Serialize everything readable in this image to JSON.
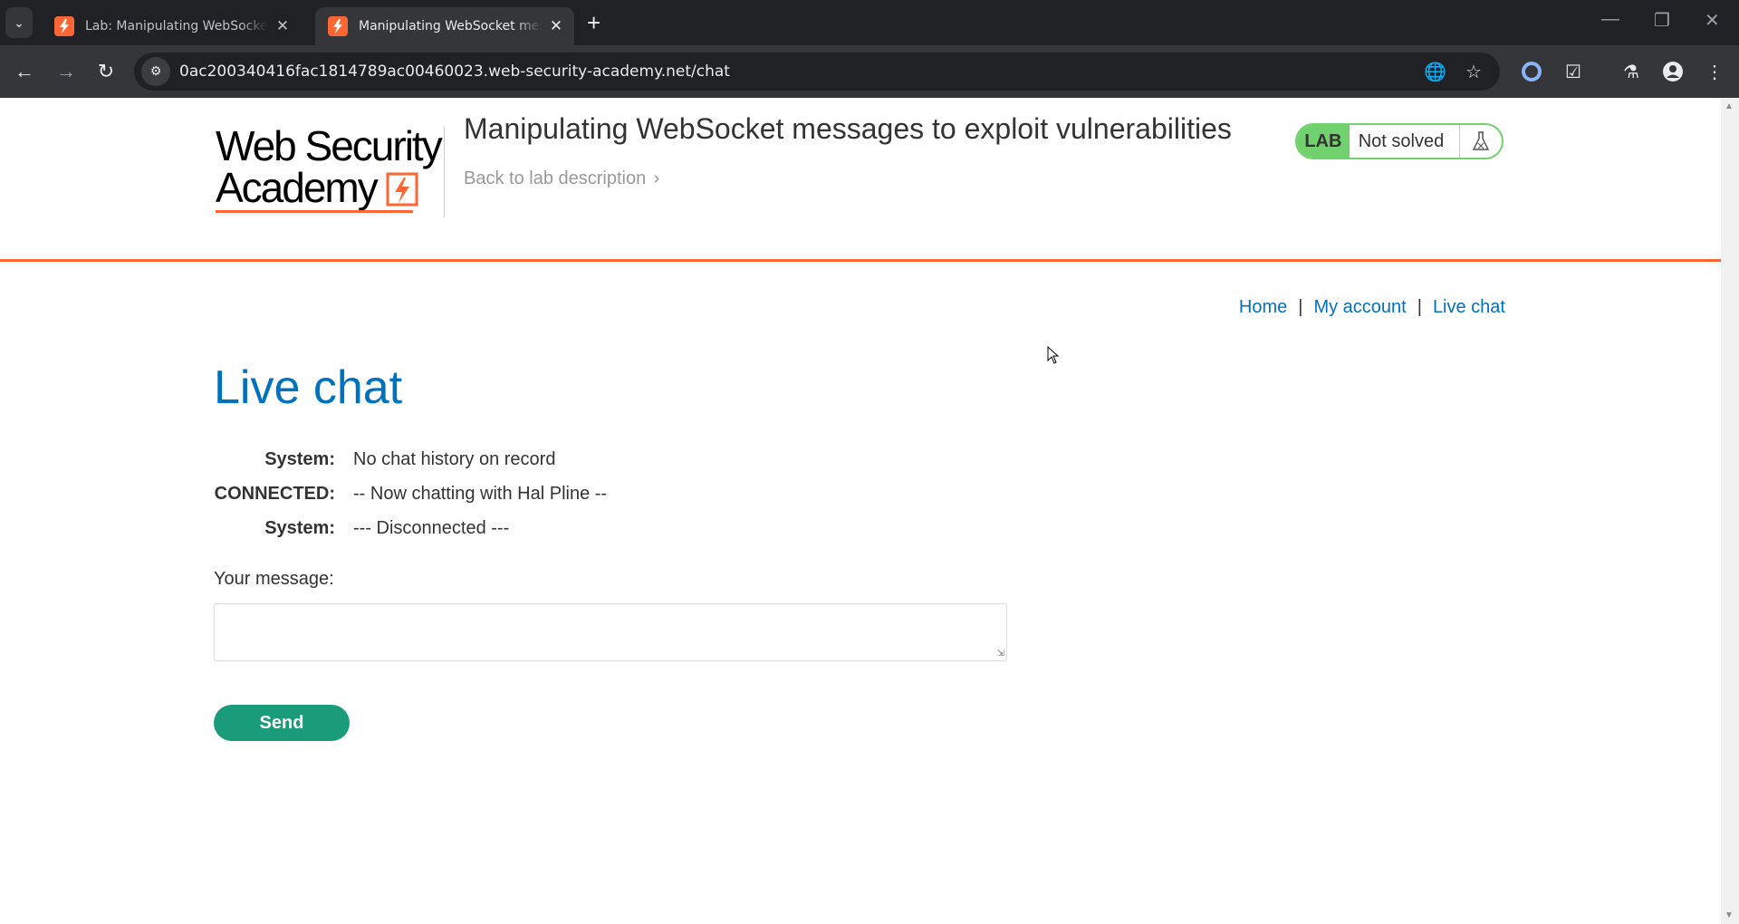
{
  "browser": {
    "tabs": [
      {
        "title": "Lab: Manipulating WebSocket m",
        "active": false
      },
      {
        "title": "Manipulating WebSocket messa",
        "active": true
      }
    ],
    "address": "0ac200340416fac1814789ac00460023.web-security-academy.net/chat",
    "icons": {
      "tab_search": "chevron-down-icon",
      "new_tab": "plus-icon",
      "back": "arrow-left-icon",
      "forward": "arrow-right-icon",
      "reload": "reload-icon",
      "site_info": "tune-icon",
      "translate": "translate-icon",
      "bookmark": "star-icon",
      "extensions": "puzzle-icon",
      "profile": "person-icon",
      "menu": "kebab-icon"
    }
  },
  "header": {
    "logo_line1": "Web Security",
    "logo_line2": "Academy",
    "lab_title": "Manipulating WebSocket messages to exploit vulnerabilities",
    "back_link": "Back to lab description",
    "lab_badge_label": "LAB",
    "lab_status": "Not solved"
  },
  "nav": {
    "home": "Home",
    "sep": "|",
    "my_account": "My account",
    "live_chat": "Live chat"
  },
  "main": {
    "title": "Live chat",
    "messages": [
      {
        "who": "System:",
        "text": "No chat history on record"
      },
      {
        "who": "CONNECTED:",
        "text": "-- Now chatting with Hal Pline --"
      },
      {
        "who": "System:",
        "text": "--- Disconnected ---"
      }
    ],
    "message_label": "Your message:",
    "message_value": "",
    "send_label": "Send"
  },
  "colors": {
    "brand_orange": "#ff6633",
    "link_blue": "#0071bc",
    "lab_green": "#70d16d",
    "button_green": "#1a9b7a"
  }
}
